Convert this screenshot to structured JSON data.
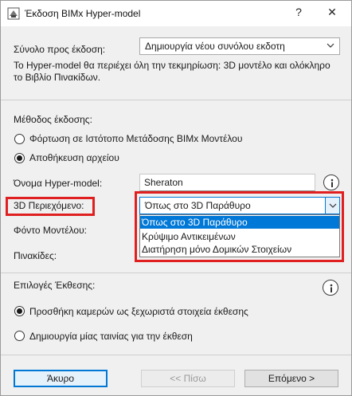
{
  "window": {
    "title": "Έκδοση BIMx Hyper-model",
    "help": "?",
    "close": "✕"
  },
  "set": {
    "label": "Σύνολο προς έκδοση:",
    "value": "Δημιουργία νέου συνόλου εκδοτη",
    "description": "Το Hyper-model θα περιέχει όλη την τεκμηρίωση: 3D μοντέλο και ολόκληρο το Βιβλίο Πινακίδων."
  },
  "method": {
    "label": "Μέθοδος έκδοσης:",
    "options": [
      {
        "label": "Φόρτωση σε Ιστότοπο Μετάδοσης BIMx Μοντέλου",
        "selected": false
      },
      {
        "label": "Αποθήκευση αρχείου",
        "selected": true
      }
    ]
  },
  "hypermodel": {
    "label": "Όνομα Hyper-model:",
    "value": "Sheraton"
  },
  "content3d": {
    "label": "3D Περιεχόμενο:",
    "value": "Όπως στο 3D Παράθυρο",
    "options": [
      "Όπως στο 3D Παράθυρο",
      "Κρύψιμο Αντικειμένων",
      "Διατήρηση μόνο Δομικών Στοιχείων"
    ],
    "selected_index": 0
  },
  "model_background": {
    "label": "Φόντο Μοντέλου:"
  },
  "layouts": {
    "label": "Πινακίδες:"
  },
  "presentation": {
    "label": "Επιλογές Έκθεσης:",
    "options": [
      {
        "label": "Προσθήκη καμερών ως ξεχωριστά στοιχεία έκθεσης",
        "selected": true
      },
      {
        "label": "Δημιουργία μίας ταινίας για την έκθεση",
        "selected": false
      }
    ]
  },
  "footer": {
    "cancel": "Άκυρο",
    "back": "<< Πίσω",
    "next": "Επόμενο >"
  },
  "colors": {
    "highlight": "#e02020",
    "accent": "#0078d7"
  }
}
